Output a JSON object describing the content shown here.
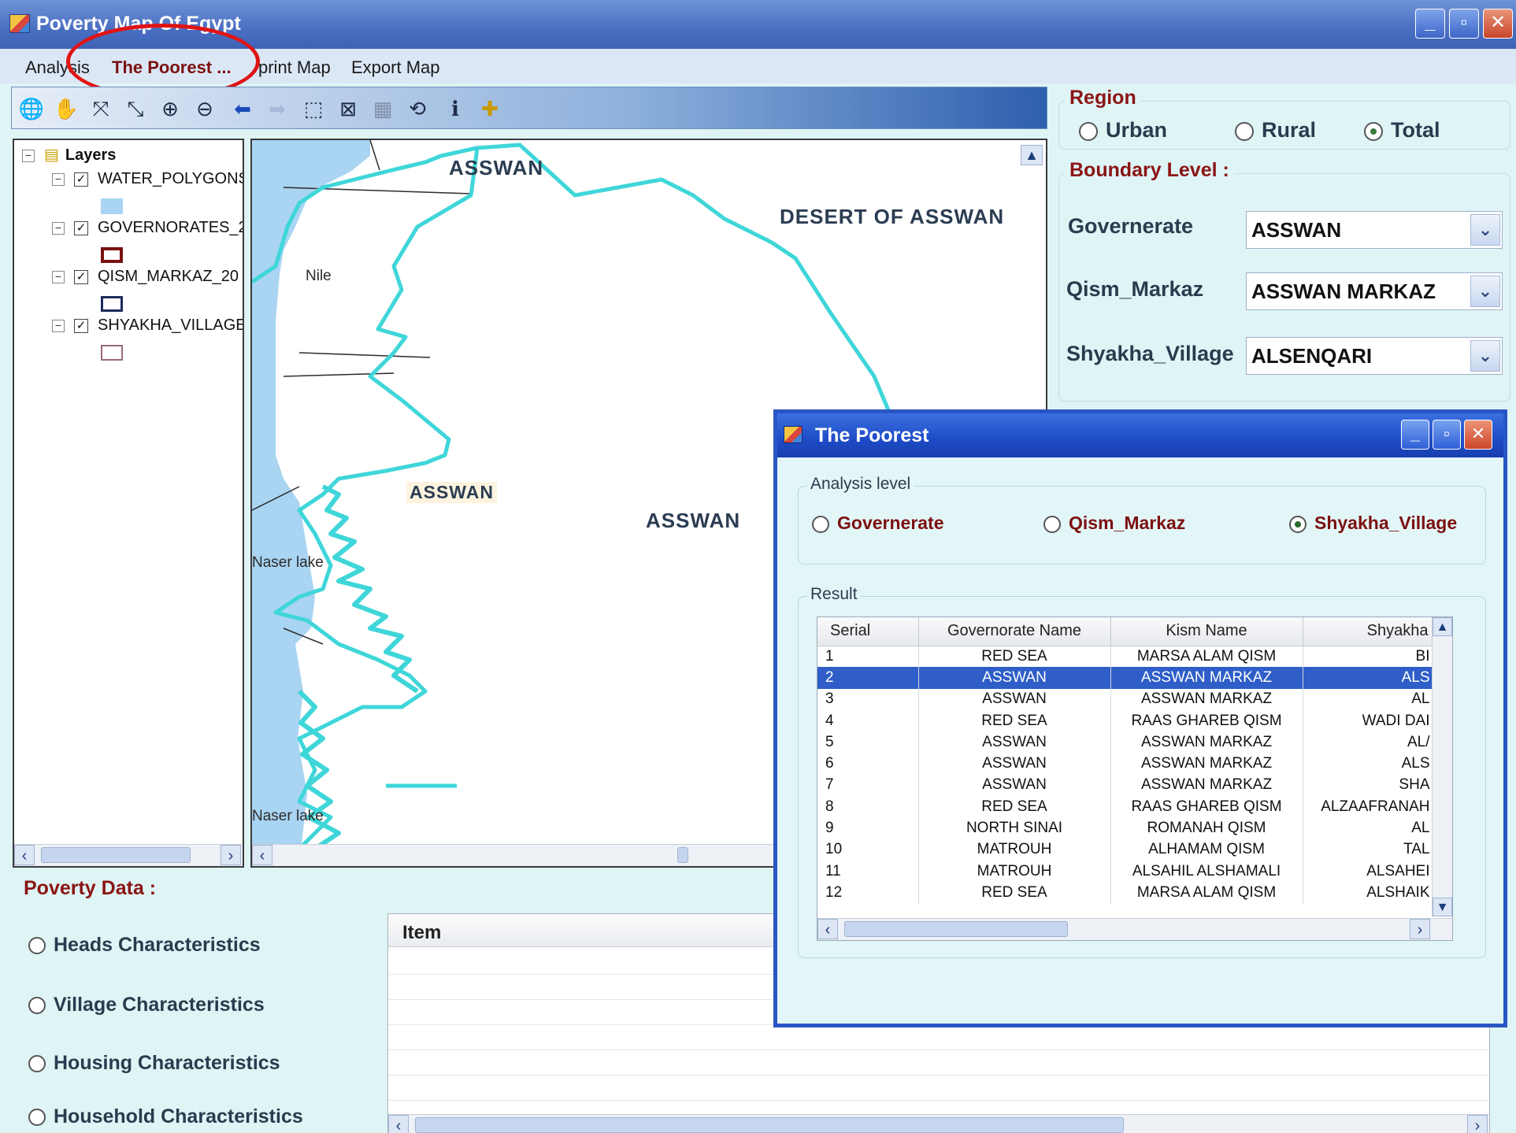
{
  "window": {
    "title": "Poverty Map Of Egypt",
    "minimize": "_",
    "maximize": "▫",
    "close": "✕"
  },
  "menu": {
    "items": [
      "Analysis",
      "The Poorest ...",
      "print Map",
      "Export Map"
    ]
  },
  "toolbar": {
    "icons": [
      "globe-icon",
      "pan-hand-icon",
      "full-extent-icon",
      "fixed-zoom-icon",
      "zoom-in-icon",
      "zoom-out-icon",
      "back-arrow-icon",
      "forward-arrow-icon",
      "select-features-icon",
      "clear-selection-icon",
      "select-elements-icon",
      "refresh-icon",
      "identify-info-icon",
      "add-data-icon"
    ]
  },
  "layers": {
    "root": "Layers",
    "items": [
      {
        "name": "WATER_POLYGONS",
        "swatch_fill": "#a9d4f2",
        "swatch_stroke": "#a9d4f2"
      },
      {
        "name": "GOVERNORATES_2",
        "swatch_fill": "#ffffff",
        "swatch_stroke": "#7a1010"
      },
      {
        "name": "QISM_MARKAZ_20",
        "swatch_fill": "#ffffff",
        "swatch_stroke": "#1e2b5a"
      },
      {
        "name": "SHYAKHA_VILLAGE",
        "swatch_fill": "#ffffff",
        "swatch_stroke": "#9a6a7a"
      }
    ]
  },
  "map": {
    "labels": {
      "asswan_top": "ASSWAN",
      "desert": "DESERT OF ASSWAN",
      "nile": "Nile",
      "asswan_tag": "ASSWAN",
      "asswan_center": "ASSWAN",
      "naser1": "Naser lake",
      "naser2": "Naser lake"
    },
    "water_color": "#a9d4f2",
    "boundary_color": "#3fd6d9"
  },
  "region": {
    "title": "Region",
    "options": [
      "Urban",
      "Rural",
      "Total"
    ],
    "selected": "Total"
  },
  "boundary": {
    "title": "Boundary Level :",
    "governerate_label": "Governerate",
    "governerate_value": "ASSWAN",
    "qism_label": "Qism_Markaz",
    "qism_value": "ASSWAN MARKAZ",
    "shyakha_label": "Shyakha_Village",
    "shyakha_value": "ALSENQARI"
  },
  "poverty": {
    "title": "Poverty Data  :",
    "options": [
      "Heads Characteristics",
      "Village Characteristics",
      "Housing Characteristics",
      "Household Characteristics"
    ],
    "grid_header": "Item"
  },
  "dialog": {
    "title": "The Poorest",
    "analysis_legend": "Analysis level",
    "analysis_options": [
      "Governerate",
      "Qism_Markaz",
      "Shyakha_Village"
    ],
    "analysis_selected": "Shyakha_Village",
    "result_legend": "Result",
    "columns": [
      "Serial",
      "Governorate Name",
      "Kism Name",
      "Shyakha"
    ],
    "rows": [
      [
        "1",
        "RED SEA",
        "MARSA ALAM QISM",
        "BI"
      ],
      [
        "2",
        "ASSWAN",
        "ASSWAN MARKAZ",
        "ALS"
      ],
      [
        "3",
        "ASSWAN",
        "ASSWAN MARKAZ",
        "AL"
      ],
      [
        "4",
        "RED SEA",
        "RAAS GHAREB QISM",
        "WADI DAI"
      ],
      [
        "5",
        "ASSWAN",
        "ASSWAN MARKAZ",
        "AL/"
      ],
      [
        "6",
        "ASSWAN",
        "ASSWAN MARKAZ",
        "ALS"
      ],
      [
        "7",
        "ASSWAN",
        "ASSWAN MARKAZ",
        "SHA"
      ],
      [
        "8",
        "RED SEA",
        "RAAS GHAREB QISM",
        "ALZAAFRANAH"
      ],
      [
        "9",
        "NORTH SINAI",
        "ROMANAH QISM",
        "AL"
      ],
      [
        "10",
        "MATROUH",
        "ALHAMAM QISM",
        "TAL"
      ],
      [
        "11",
        "MATROUH",
        "ALSAHIL ALSHAMALI",
        "ALSAHEI"
      ],
      [
        "12",
        "RED SEA",
        "MARSA ALAM QISM",
        "ALSHAIK"
      ]
    ],
    "selected_row": "2"
  },
  "colors": {
    "accent_red": "#8b1414",
    "selection_blue": "#2f5ec8",
    "panel_bg": "#dff4f5",
    "highlight_ring": "#e01414"
  }
}
